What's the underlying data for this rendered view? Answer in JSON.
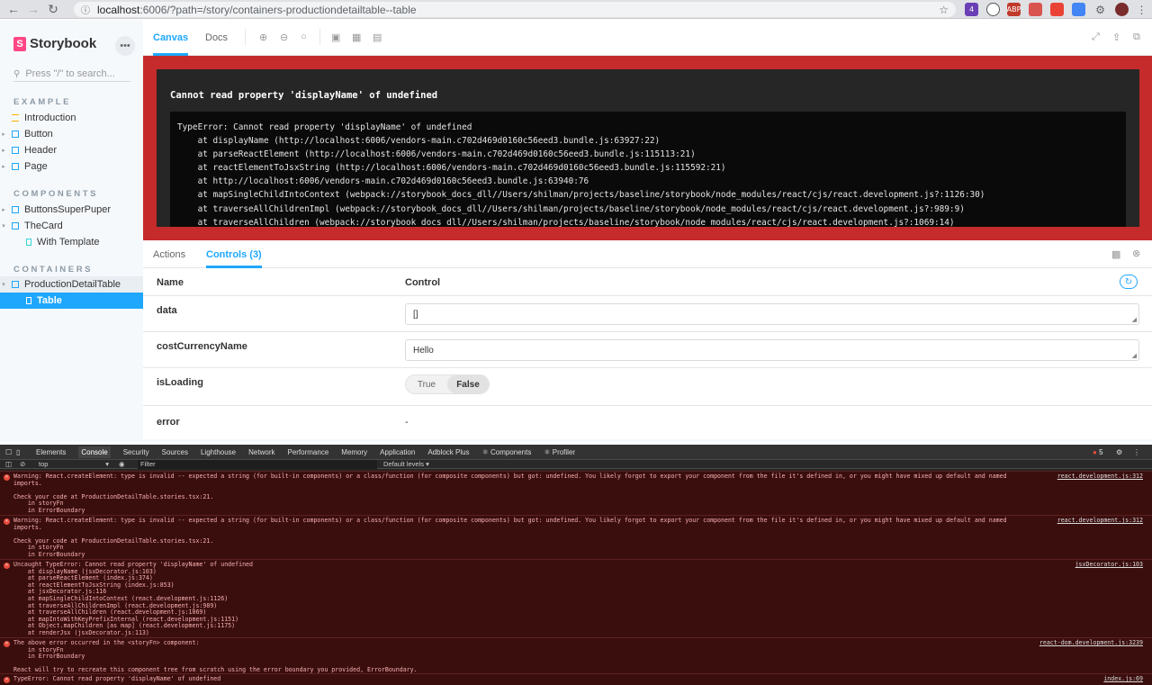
{
  "browser": {
    "url_host": "localhost",
    "url_rest": ":6006/?path=/story/containers-productiondetailtable--table",
    "extension_badge": "4",
    "ext_abp": "ABP"
  },
  "sidebar": {
    "brand": "Storybook",
    "search_placeholder": "Press \"/\" to search...",
    "sections": [
      {
        "title": "EXAMPLE"
      },
      {
        "title": "COMPONENTS"
      },
      {
        "title": "CONTAINERS"
      }
    ],
    "items": [
      {
        "label": "Introduction"
      },
      {
        "label": "Button"
      },
      {
        "label": "Header"
      },
      {
        "label": "Page"
      },
      {
        "label": "ButtonsSuperPuper"
      },
      {
        "label": "TheCard"
      },
      {
        "label": "With Template"
      },
      {
        "label": "ProductionDetailTable"
      },
      {
        "label": "Table"
      }
    ]
  },
  "toolbar": {
    "tab_canvas": "Canvas",
    "tab_docs": "Docs"
  },
  "error": {
    "title": "Cannot read property 'displayName' of undefined",
    "stack": "TypeError: Cannot read property 'displayName' of undefined\n    at displayName (http://localhost:6006/vendors-main.c702d469d0160c56eed3.bundle.js:63927:22)\n    at parseReactElement (http://localhost:6006/vendors-main.c702d469d0160c56eed3.bundle.js:115113:21)\n    at reactElementToJsxString (http://localhost:6006/vendors-main.c702d469d0160c56eed3.bundle.js:115592:21)\n    at http://localhost:6006/vendors-main.c702d469d0160c56eed3.bundle.js:63940:76\n    at mapSingleChildIntoContext (webpack://storybook_docs_dll//Users/shilman/projects/baseline/storybook/node_modules/react/cjs/react.development.js?:1126:30)\n    at traverseAllChildrenImpl (webpack://storybook_docs_dll//Users/shilman/projects/baseline/storybook/node_modules/react/cjs/react.development.js?:989:9)\n    at traverseAllChildren (webpack://storybook_docs_dll//Users/shilman/projects/baseline/storybook/node_modules/react/cjs/react.development.js?:1069:14)"
  },
  "panel": {
    "tab_actions": "Actions",
    "tab_controls": "Controls (3)",
    "col_name": "Name",
    "col_control": "Control",
    "rows": [
      {
        "name": "data",
        "value": "[]"
      },
      {
        "name": "costCurrencyName",
        "value": "Hello"
      },
      {
        "name": "isLoading",
        "opt_true": "True",
        "opt_false": "False"
      },
      {
        "name": "error",
        "value": "-"
      }
    ]
  },
  "devtools": {
    "tabs": [
      "Elements",
      "Console",
      "Security",
      "Sources",
      "Lighthouse",
      "Network",
      "Performance",
      "Memory",
      "Application",
      "Adblock Plus",
      "Components",
      "Profiler"
    ],
    "error_count": "5",
    "context": "top",
    "filter_placeholder": "Filter",
    "levels": "Default levels",
    "messages": [
      {
        "text": "Warning: React.createElement: type is invalid -- expected a string (for built-in components) or a class/function (for composite components) but got: undefined. You likely forgot to export your component from the file it's defined in, or you might have mixed up default and named\nimports.\n\nCheck your code at ProductionDetailTable.stories.tsx:21.\n    in storyFn\n    in ErrorBoundary",
        "source": "react.development.js:312"
      },
      {
        "text": "Warning: React.createElement: type is invalid -- expected a string (for built-in components) or a class/function (for composite components) but got: undefined. You likely forgot to export your component from the file it's defined in, or you might have mixed up default and named\nimports.\n\nCheck your code at ProductionDetailTable.stories.tsx:21.\n    in storyFn\n    in ErrorBoundary",
        "source": "react.development.js:312"
      },
      {
        "text": "Uncaught TypeError: Cannot read property 'displayName' of undefined\n    at displayName (jsxDecorator.js:103)\n    at parseReactElement (index.js:374)\n    at reactElementToJsxString (index.js:853)\n    at jsxDecorator.js:116\n    at mapSingleChildIntoContext (react.development.js:1126)\n    at traverseAllChildrenImpl (react.development.js:989)\n    at traverseAllChildren (react.development.js:1069)\n    at mapIntoWithKeyPrefixInternal (react.development.js:1151)\n    at Object.mapChildren [as map] (react.development.js:1175)\n    at renderJsx (jsxDecorator.js:113)",
        "source": "jsxDecorator.js:103"
      },
      {
        "text": "The above error occurred in the <storyFn> component:\n    in storyFn\n    in ErrorBoundary\n\nReact will try to recreate this component tree from scratch using the error boundary you provided, ErrorBoundary.",
        "source": "react-dom.development.js:3239"
      },
      {
        "text": "TypeError: Cannot read property 'displayName' of undefined",
        "source": "index.js:69"
      }
    ]
  },
  "colors": {
    "accent": "#1ea7fd",
    "error_bg": "#c52b2b",
    "brand": "#ff4785"
  }
}
